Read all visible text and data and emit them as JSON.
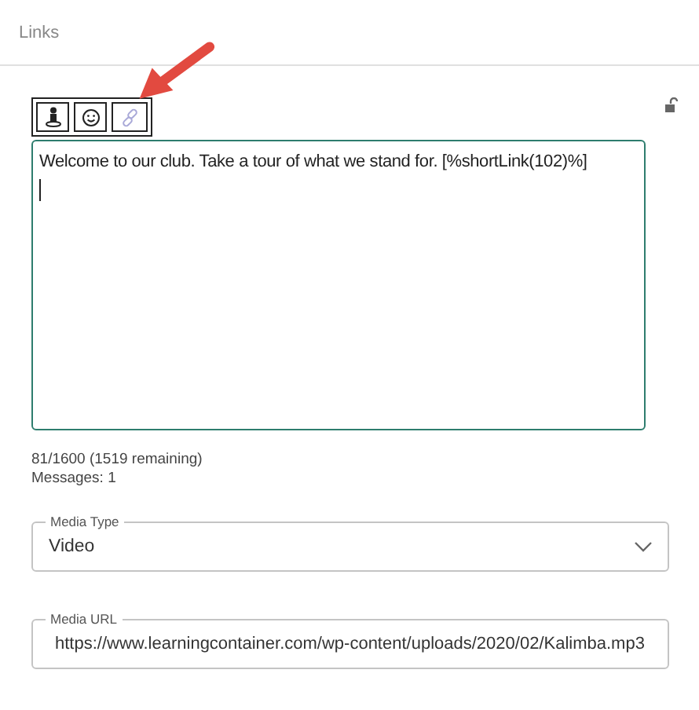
{
  "header": {
    "title": "Links"
  },
  "toolbar": [
    {
      "kind": "person",
      "disabled": false
    },
    {
      "kind": "emoji",
      "disabled": false
    },
    {
      "kind": "link",
      "disabled": true
    }
  ],
  "message": {
    "value": "Welcome to our club. Take a tour of what we stand for. [%shortLink(102)%]"
  },
  "counter": "81/1600 (1519 remaining)",
  "messages": "Messages: 1",
  "media_type": {
    "label": "Media Type",
    "value": "Video"
  },
  "media_url": {
    "label": "Media URL",
    "value": "https://www.learningcontainer.com/wp-content/uploads/2020/02/Kalimba.mp3"
  }
}
